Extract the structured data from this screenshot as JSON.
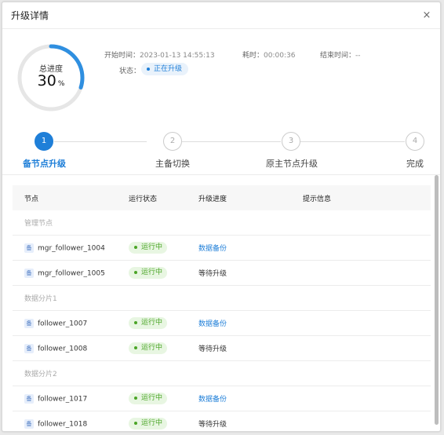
{
  "dialog": {
    "title": "升级详情",
    "close_glyph": "×"
  },
  "progress": {
    "label": "总进度",
    "value": "30",
    "unit": "%",
    "fraction": 0.3,
    "accent": "#2f8fe0"
  },
  "info": {
    "start_label": "开始时间：",
    "start_value": "2023-01-13 14:55:13",
    "elapsed_label": "耗时：",
    "elapsed_value": "00:00:36",
    "end_label": "结束时间：",
    "end_value": "--",
    "status_label": "状态：",
    "status_value": "正在升级"
  },
  "steps": [
    {
      "num": "1",
      "label": "备节点升级",
      "state": "active"
    },
    {
      "num": "2",
      "label": "主备切换",
      "state": "pending"
    },
    {
      "num": "3",
      "label": "原主节点升级",
      "state": "pending"
    },
    {
      "num": "4",
      "label": "完成",
      "state": "pending"
    }
  ],
  "table": {
    "headers": [
      "节点",
      "运行状态",
      "升级进度",
      "提示信息"
    ],
    "rows": [
      {
        "type": "group",
        "name": "管理节点"
      },
      {
        "type": "node",
        "icon": "备",
        "name": "mgr_follower_1004",
        "status": "运行中",
        "progress": "数据备份",
        "progress_kind": "link"
      },
      {
        "type": "node",
        "icon": "备",
        "name": "mgr_follower_1005",
        "status": "运行中",
        "progress": "等待升级",
        "progress_kind": "wait"
      },
      {
        "type": "group",
        "name": "数据分片1"
      },
      {
        "type": "node",
        "icon": "备",
        "name": "follower_1007",
        "status": "运行中",
        "progress": "数据备份",
        "progress_kind": "link"
      },
      {
        "type": "node",
        "icon": "备",
        "name": "follower_1008",
        "status": "运行中",
        "progress": "等待升级",
        "progress_kind": "wait"
      },
      {
        "type": "group",
        "name": "数据分片2"
      },
      {
        "type": "node",
        "icon": "备",
        "name": "follower_1017",
        "status": "运行中",
        "progress": "数据备份",
        "progress_kind": "link"
      },
      {
        "type": "node",
        "icon": "备",
        "name": "follower_1018",
        "status": "运行中",
        "progress": "等待升级",
        "progress_kind": "wait"
      }
    ]
  }
}
